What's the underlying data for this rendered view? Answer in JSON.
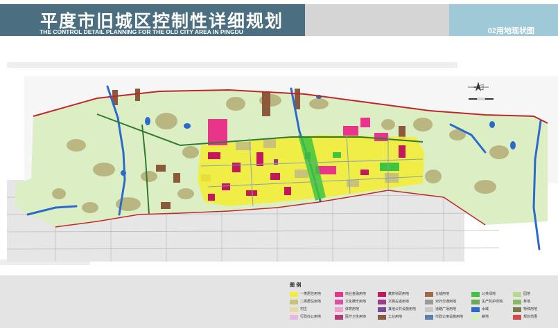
{
  "header": {
    "title": "平度市旧城区控制性详细规划",
    "subtitle": "THE CONTROL DETAIL PLANNING FOR THE OLD CITY AREA IN PINGDU",
    "drawing_label": "02用地现状图"
  },
  "legend": {
    "title": "图 例",
    "items": [
      {
        "label": "一类居住用地",
        "color": "#f2ec3a"
      },
      {
        "label": "二类居住用地",
        "color": "#c9c27a"
      },
      {
        "label": "村庄",
        "color": "#e7d9a4"
      },
      {
        "label": "行政办公用地",
        "color": "#e8b6e0"
      },
      {
        "label": "商业金融用地",
        "color": "#e8358a"
      },
      {
        "label": "文化娱乐用地",
        "color": "#d94fa6"
      },
      {
        "label": "体育用地",
        "color": "#f0a0c8"
      },
      {
        "label": "医疗卫生用地",
        "color": "#b33a7a"
      },
      {
        "label": "教育科研用地",
        "color": "#c4185c"
      },
      {
        "label": "文物古迹用地",
        "color": "#9b3d88"
      },
      {
        "label": "其他公共设施用地",
        "color": "#7a4a9a"
      },
      {
        "label": "工业用地",
        "color": "#8b5a3c"
      },
      {
        "label": "仓储用地",
        "color": "#a06a4a"
      },
      {
        "label": "对外交通用地",
        "color": "#9a9a9a"
      },
      {
        "label": "道路广场用地",
        "color": "#c8c8c8"
      },
      {
        "label": "市政公用设施用地",
        "color": "#5a7fb0"
      },
      {
        "label": "公共绿地",
        "color": "#3ec43e"
      },
      {
        "label": "生产防护绿地",
        "color": "#6aa85a"
      },
      {
        "label": "水域",
        "color": "#2a6acc"
      },
      {
        "label": "耕地",
        "color": "#d8efc0"
      },
      {
        "label": "园地",
        "color": "#b8d890"
      },
      {
        "label": "林地",
        "color": "#88b868"
      },
      {
        "label": "特殊用地",
        "color": "#7a7a4a"
      },
      {
        "label": "规划范围",
        "color": "#d24a4a"
      }
    ]
  }
}
